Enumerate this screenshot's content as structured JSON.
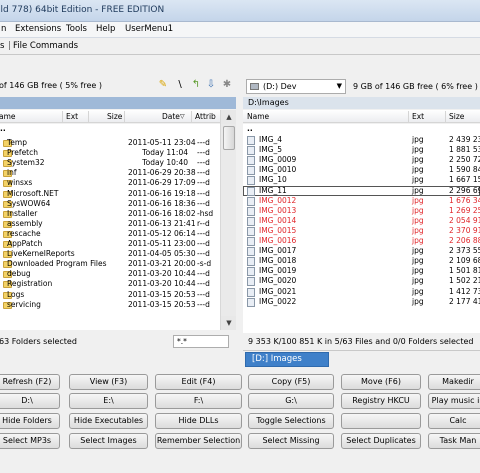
{
  "window": {
    "title": "ild 778) 64bit Edition - FREE EDITION"
  },
  "menu": {
    "items": [
      "n",
      "Extensions",
      "Tools",
      "Help",
      "UserMenu1"
    ]
  },
  "command_bar": {
    "tabs": [
      "s",
      "File Commands"
    ]
  },
  "left_panel": {
    "free_space": "of 146 GB free ( 5% free )",
    "columns": {
      "name": "ame",
      "ext": "Ext",
      "size": "Size",
      "date": "Date",
      "attrib": "Attrib"
    },
    "rows": [
      {
        "name": "..",
        "date": "",
        "attrib": ""
      },
      {
        "name": "Temp",
        "date": "2011-05-11 23:04",
        "attrib": "---d"
      },
      {
        "name": "Prefetch",
        "date": "Today 11:04",
        "attrib": "---d"
      },
      {
        "name": "System32",
        "date": "Today 10:40",
        "attrib": "---d"
      },
      {
        "name": "inf",
        "date": "2011-06-29 20:38",
        "attrib": "---d"
      },
      {
        "name": "winsxs",
        "date": "2011-06-29 17:09",
        "attrib": "---d"
      },
      {
        "name": "Microsoft.NET",
        "date": "2011-06-16 19:18",
        "attrib": "---d"
      },
      {
        "name": "SysWOW64",
        "date": "2011-06-16 18:36",
        "attrib": "---d"
      },
      {
        "name": "Installer",
        "date": "2011-06-16 18:02",
        "attrib": "-hsd"
      },
      {
        "name": "assembly",
        "date": "2011-06-13 21:41",
        "attrib": "r--d"
      },
      {
        "name": "rescache",
        "date": "2011-05-12 06:14",
        "attrib": "---d"
      },
      {
        "name": "AppPatch",
        "date": "2011-05-11 23:00",
        "attrib": "---d"
      },
      {
        "name": "LiveKernelReports",
        "date": "2011-04-05 05:30",
        "attrib": "---d"
      },
      {
        "name": "Downloaded Program Files",
        "date": "2011-03-21 20:00",
        "attrib": "-s-d"
      },
      {
        "name": "debug",
        "date": "2011-03-20 10:44",
        "attrib": "---d"
      },
      {
        "name": "Registration",
        "date": "2011-03-20 10:44",
        "attrib": "---d"
      },
      {
        "name": "Logs",
        "date": "2011-03-15 20:53",
        "attrib": "---d"
      },
      {
        "name": "servicing",
        "date": "2011-03-15 20:53",
        "attrib": "---d"
      }
    ],
    "status": "63 Folders selected",
    "filter": "*.*"
  },
  "right_panel": {
    "drive": "(D:) Dev",
    "free_space": "9 GB of 146 GB free ( 6% free )",
    "path": "D:\\Images",
    "columns": {
      "name": "Name",
      "ext": "Ext",
      "size": "Size"
    },
    "rows": [
      {
        "name": "..",
        "ext": "",
        "size": ""
      },
      {
        "name": "IMG_4",
        "ext": "jpg",
        "size": "2 439 23"
      },
      {
        "name": "IMG_5",
        "ext": "jpg",
        "size": "1 881 53"
      },
      {
        "name": "IMG_0009",
        "ext": "jpg",
        "size": "2 250 72"
      },
      {
        "name": "IMG_0010",
        "ext": "jpg",
        "size": "1 590 84"
      },
      {
        "name": "IMG_10",
        "ext": "jpg",
        "size": "1 667 15"
      },
      {
        "name": "IMG_11",
        "ext": "jpg",
        "size": "2 296 69"
      },
      {
        "name": "IMG_0012",
        "ext": "jpg",
        "size": "1 676 34"
      },
      {
        "name": "IMG_0013",
        "ext": "jpg",
        "size": "1 269 25"
      },
      {
        "name": "IMG_0014",
        "ext": "jpg",
        "size": "2 054 91"
      },
      {
        "name": "IMG_0015",
        "ext": "jpg",
        "size": "2 370 91"
      },
      {
        "name": "IMG_0016",
        "ext": "jpg",
        "size": "2 206 88"
      },
      {
        "name": "IMG_0017",
        "ext": "jpg",
        "size": "2 373 55"
      },
      {
        "name": "IMG_0018",
        "ext": "jpg",
        "size": "2 109 68"
      },
      {
        "name": "IMG_0019",
        "ext": "jpg",
        "size": "1 501 81"
      },
      {
        "name": "IMG_0020",
        "ext": "jpg",
        "size": "1 502 21"
      },
      {
        "name": "IMG_0021",
        "ext": "jpg",
        "size": "1 412 73"
      },
      {
        "name": "IMG_0022",
        "ext": "jpg",
        "size": "2 177 41"
      }
    ],
    "status": "9 353 K/100 851 K in 5/63 Files and 0/0 Folders selected",
    "tab": "[D:] Images"
  },
  "buttons": [
    [
      "Refresh (F2)",
      "View (F3)",
      "Edit (F4)",
      "Copy (F5)",
      "Move (F6)",
      "Makedir"
    ],
    [
      "D:\\",
      "E:\\",
      "F:\\",
      "G:\\",
      "Registry HKCU",
      "Play music in"
    ],
    [
      "Hide Folders",
      "Hide Executables",
      "Hide DLLs",
      "Toggle Selections",
      "",
      "Calc"
    ],
    [
      "Select MP3s",
      "Select Images",
      "Remember Selection",
      "Select Missing",
      "Select Duplicates",
      "Task Man"
    ]
  ],
  "colors": {
    "selected_text": "#e0262a",
    "active_tab": "#3f80c9",
    "left_path_bar": "#9fb9d8"
  }
}
